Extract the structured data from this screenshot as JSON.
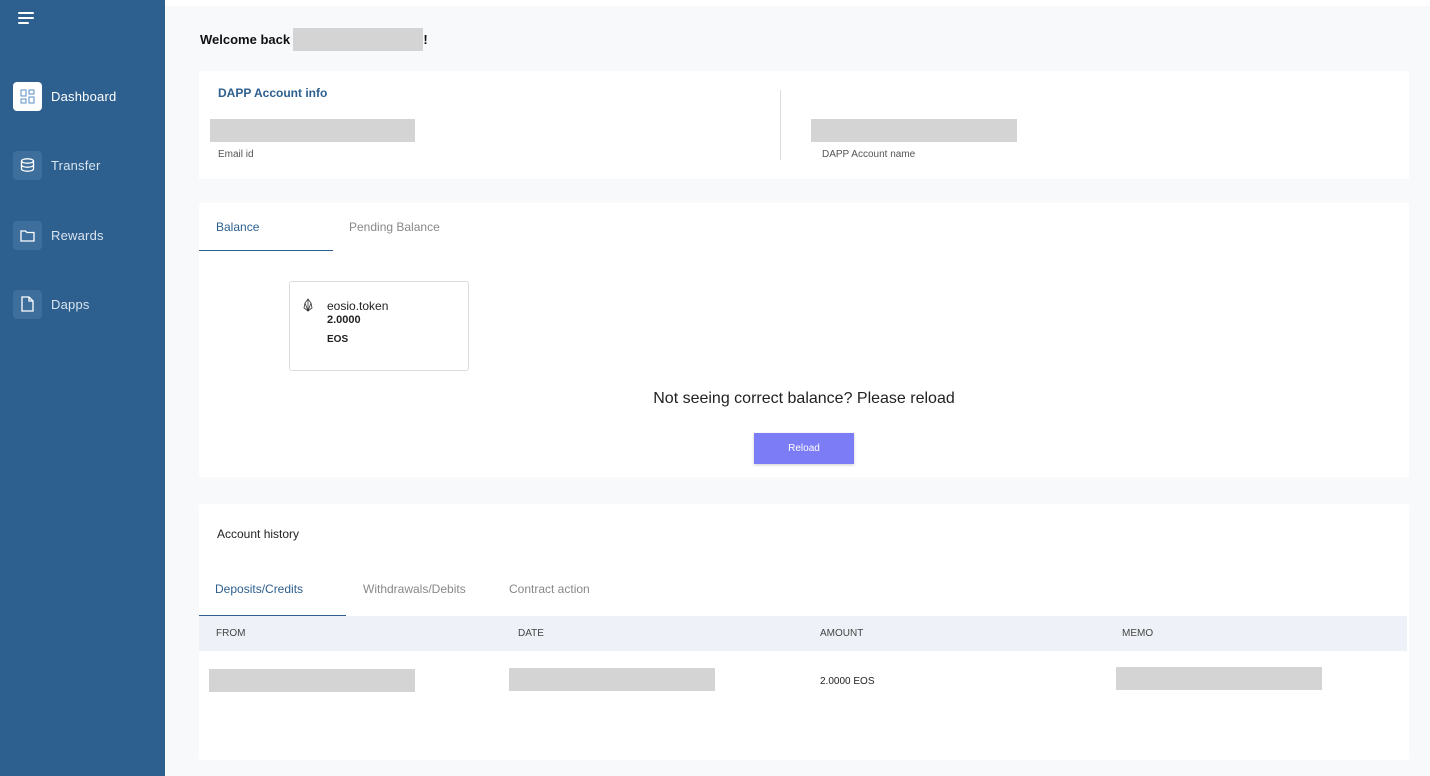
{
  "sidebar": {
    "items": [
      {
        "label": "Dashboard",
        "icon": "dashboard-grid-icon",
        "active": true
      },
      {
        "label": "Transfer",
        "icon": "coins-stack-icon",
        "active": false
      },
      {
        "label": "Rewards",
        "icon": "folder-icon",
        "active": false
      },
      {
        "label": "Dapps",
        "icon": "document-icon",
        "active": false
      }
    ]
  },
  "header": {
    "welcome_prefix": "Welcome back ,",
    "welcome_suffix": "!"
  },
  "account_info": {
    "title": "DAPP Account info",
    "email_label": "Email id",
    "account_name_label": "DAPP Account name"
  },
  "balance": {
    "tabs": [
      {
        "label": "Balance",
        "active": true
      },
      {
        "label": "Pending Balance",
        "active": false
      }
    ],
    "token": {
      "contract": "eosio.token",
      "amount": "2.0000",
      "symbol": "EOS"
    },
    "reload_message": "Not seeing correct balance? Please reload",
    "reload_button": "Reload"
  },
  "history": {
    "title": "Account history",
    "tabs": [
      {
        "label": "Deposits/Credits",
        "active": true
      },
      {
        "label": "Withdrawals/Debits",
        "active": false
      },
      {
        "label": "Contract action",
        "active": false
      }
    ],
    "columns": [
      "FROM",
      "DATE",
      "AMOUNT",
      "MEMO"
    ],
    "rows": [
      {
        "amount": "2.0000 EOS"
      }
    ]
  },
  "colors": {
    "sidebar": "#2d5f8f",
    "accent": "#2d5f8f",
    "button": "#7b7cf6"
  }
}
